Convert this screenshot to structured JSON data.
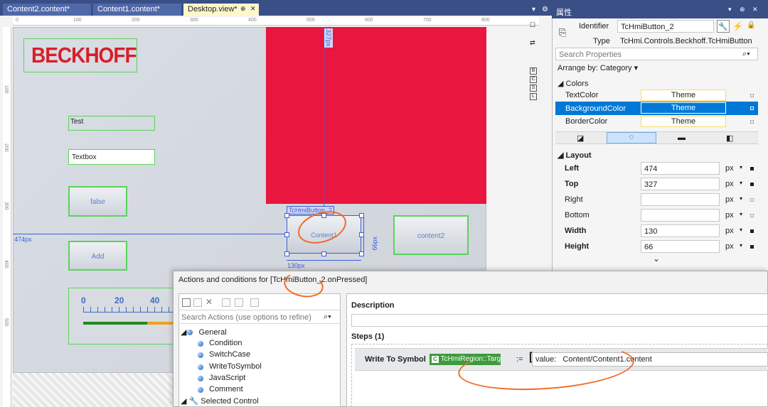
{
  "tabs": [
    {
      "label": "Content2.content*"
    },
    {
      "label": "Content1.content*"
    },
    {
      "label": "Desktop.view*",
      "pin": "⊕",
      "close": "✕"
    }
  ],
  "rulers": {
    "h": [
      "0",
      "100",
      "200",
      "300",
      "400",
      "500",
      "600",
      "700",
      "800"
    ],
    "v": [
      "100",
      "200",
      "300",
      "400",
      "500"
    ]
  },
  "designer": {
    "logo_text": "BECKHOFF",
    "top_dim": "327px",
    "label_text": "Test",
    "textbox_text": "Textbox",
    "toggle_label": "false",
    "add_label": "Add",
    "selected_tag": "TcHmiButton_2",
    "selected_label": "Content1",
    "content2_label": "content2",
    "left_dim": "474px",
    "width_dim": "130px",
    "height_dim": "66px",
    "gauge_ticks": [
      "0",
      "20",
      "40"
    ],
    "side_tools": [
      "B",
      "C",
      "S",
      "L"
    ]
  },
  "properties": {
    "title": "属性",
    "identifier_label": "Identifier",
    "identifier_value": "TcHmiButton_2",
    "type_label": "Type",
    "type_value": "TcHmi.Controls.Beckhoff.TcHmiButton",
    "search_placeholder": "Search Properties",
    "arrange_by": "Arrange by: Category",
    "colors_section": "Colors",
    "colors": [
      {
        "name": "TextColor",
        "value": "Theme"
      },
      {
        "name": "BackgroundColor",
        "value": "Theme"
      },
      {
        "name": "BorderColor",
        "value": "Theme"
      }
    ],
    "layout_section": "Layout",
    "layout": [
      {
        "name": "Left",
        "value": "474",
        "unit": "px"
      },
      {
        "name": "Top",
        "value": "327",
        "unit": "px"
      },
      {
        "name": "Right",
        "value": "",
        "unit": "px"
      },
      {
        "name": "Bottom",
        "value": "",
        "unit": "px"
      },
      {
        "name": "Width",
        "value": "130",
        "unit": "px"
      },
      {
        "name": "Height",
        "value": "66",
        "unit": "px"
      }
    ]
  },
  "dialog": {
    "title": "Actions and conditions for [TcHmiButton_2.onPressed]",
    "search_placeholder": "Search Actions (use options to refine)",
    "tree": {
      "general": "General",
      "items": [
        "Condition",
        "SwitchCase",
        "WriteToSymbol",
        "JavaScript",
        "Comment"
      ],
      "selected_control": "Selected Control"
    },
    "description_label": "Description",
    "steps_label": "Steps (1)",
    "step_name": "Write To Symbol",
    "symbol_text": "TcHmiRegion::TargetContent",
    "assign_op": ":=",
    "value_label": "value:",
    "value_text": "Content/Content1.content"
  },
  "colors": {
    "accent": "#3b5fd6",
    "red_panel": "#e9163f",
    "logo": "#d81e2b",
    "selection": "#0078d7",
    "annotation": "#ef6a24"
  }
}
